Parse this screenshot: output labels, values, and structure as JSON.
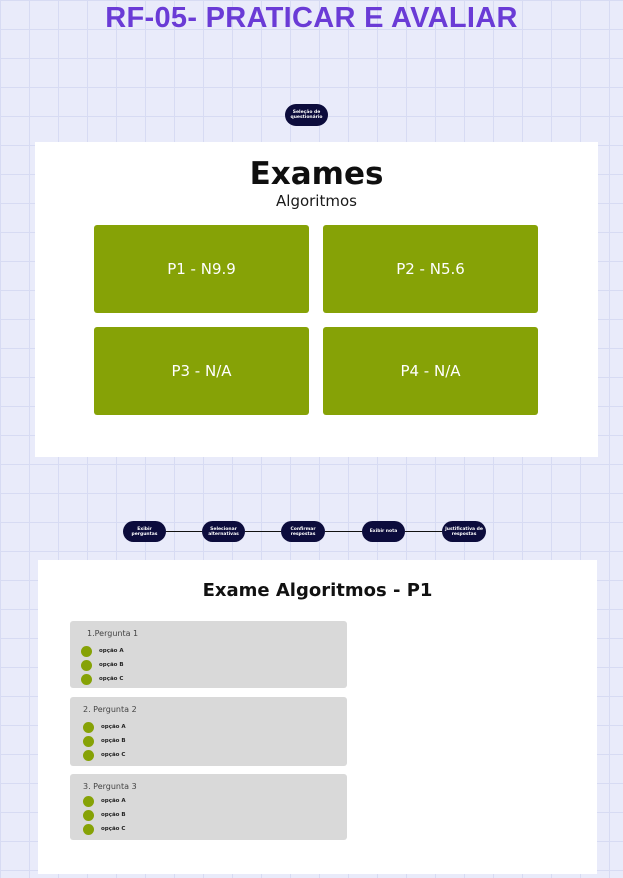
{
  "page": {
    "title": "RF-05- PRATICAR E AVALIAR"
  },
  "flow_top": {
    "label": "Seleção de questionário"
  },
  "exams_card": {
    "title": "Exames",
    "subtitle": "Algoritmos",
    "buttons": [
      "P1 - N9.9",
      "P2 - N5.6",
      "P3 - N/A",
      "P4 - N/A"
    ]
  },
  "flow_steps": [
    "Exibir perguntas",
    "Selecionar alternativas",
    "Confirmar respostas",
    "Exibir nota",
    "Justificativa de respostas"
  ],
  "quiz": {
    "title": "Exame Algoritmos - P1",
    "questions": [
      {
        "label": "1.Pergunta 1",
        "options": [
          "opção A",
          "opção B",
          "opção C"
        ]
      },
      {
        "label": "2. Pergunta 2",
        "options": [
          "opção A",
          "opção B",
          "opção C"
        ]
      },
      {
        "label": "3. Pergunta 3",
        "options": [
          "opção A",
          "opção B",
          "opção C"
        ]
      }
    ]
  },
  "colors": {
    "title": "#6a3bd6",
    "accent": "#86a206",
    "pill": "#0c0c3c"
  }
}
